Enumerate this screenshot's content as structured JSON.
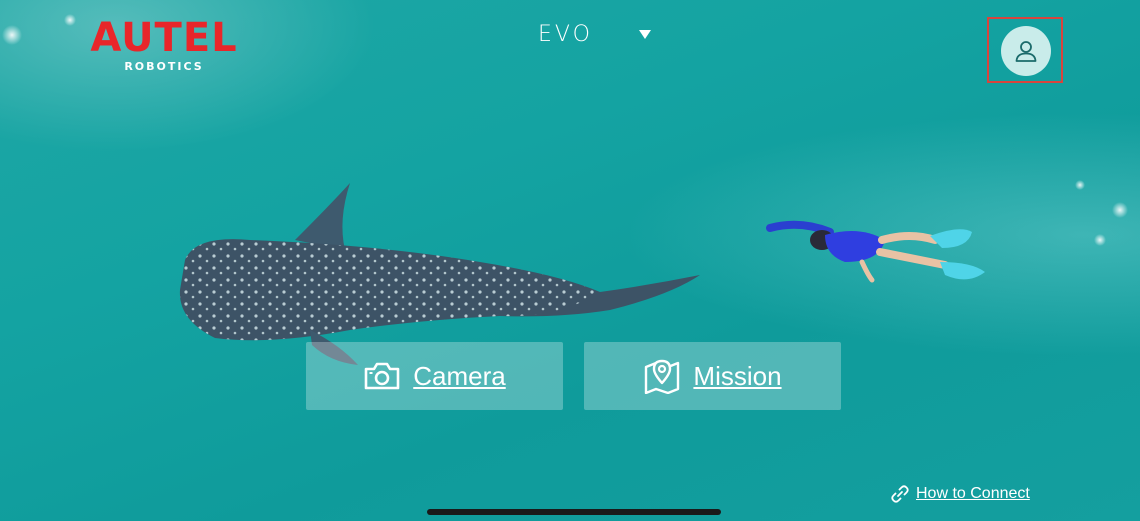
{
  "brand": {
    "logo_text": "AUTEL",
    "logo_subtext": "ROBOTICS",
    "logo_color": "#e8262a"
  },
  "header": {
    "product_name": "EVO",
    "dropdown_icon": "triangle-down-icon",
    "profile_icon": "user-icon"
  },
  "actions": {
    "camera_label": "Camera",
    "camera_icon": "camera-icon",
    "mission_label": "Mission",
    "mission_icon": "map-pin-icon"
  },
  "footer": {
    "connect_label": "How to Connect",
    "connect_icon": "link-icon"
  },
  "colors": {
    "background": "#14a3a2",
    "highlight_border": "#d9443d"
  }
}
